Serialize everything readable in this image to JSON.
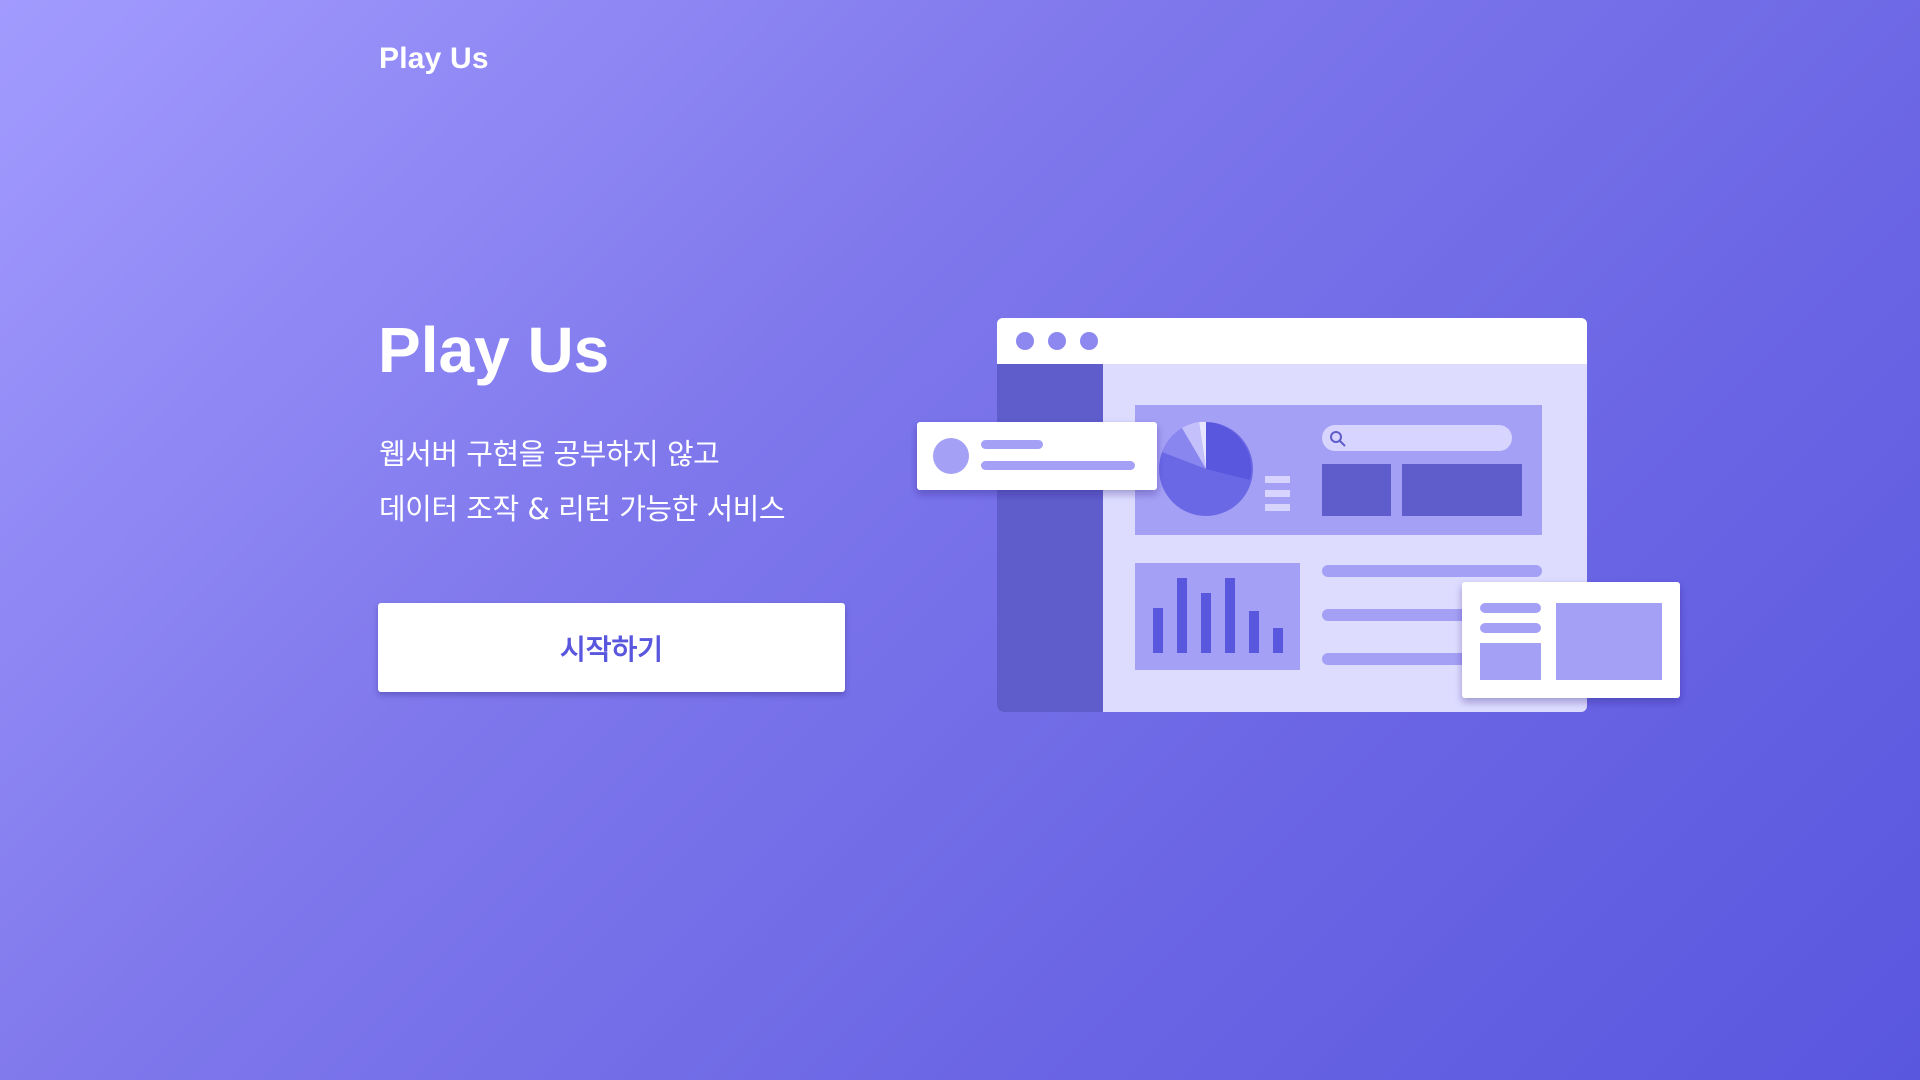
{
  "header": {
    "logo": "Play Us"
  },
  "hero": {
    "title": "Play Us",
    "subtitle_line1": "웹서버 구현을 공부하지 않고",
    "subtitle_line2": "데이터 조작 & 리턴 가능한 서비스",
    "cta_label": "시작하기"
  },
  "illustration": {
    "icons": [
      "browser-window",
      "pie-chart-icon",
      "bar-chart-icon",
      "search-icon",
      "profile-card",
      "list-card"
    ]
  },
  "colors": {
    "gradient_start": "#a29bfe",
    "gradient_end": "#5a57df",
    "accent": "#5a57df",
    "panel": "#dddcff",
    "sidebar": "#5f5ccc",
    "card": "#a4a0f5"
  }
}
